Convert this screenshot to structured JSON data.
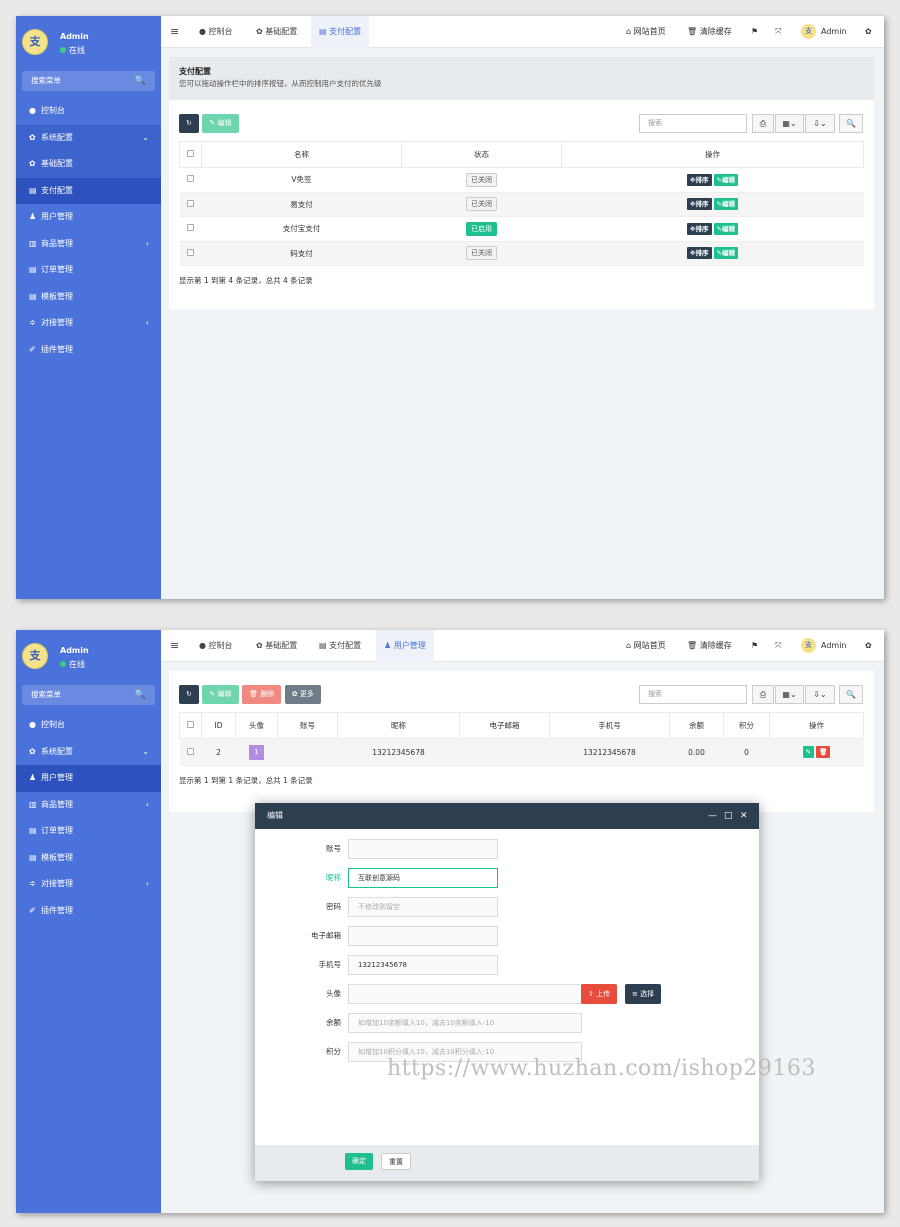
{
  "brand": {
    "logo_text": "支",
    "avatar_text": "支"
  },
  "colors": {
    "sidebar": "#4a72da",
    "accent": "#1fbf8f",
    "dark": "#2c3e50",
    "danger": "#e74c3c"
  },
  "icons": {
    "hamburger": "≡",
    "dashboard": "●",
    "gear": "✿",
    "list": "▤",
    "user": "♟",
    "cart": "▥",
    "table": "▤",
    "sliders": "≑",
    "plugin": "✐",
    "search": "🔍",
    "home": "⌂",
    "trash": "🗑",
    "flag": "⚑",
    "expand": "⤧",
    "cogs": "✿",
    "refresh": "↻",
    "pencil": "✎",
    "chevron_down": "⌄",
    "chevron_left": "‹",
    "columns": "▦",
    "export": "⇩",
    "print": "⎙",
    "move": "✥",
    "close": "✕",
    "minimize": "—",
    "maximize": "□",
    "upload": "⇧",
    "select": "≡"
  },
  "sidebar": {
    "admin_name": "Admin",
    "status": "在线",
    "search_placeholder": "搜索菜单",
    "items1": [
      {
        "icon": "●",
        "label": "控制台"
      },
      {
        "icon": "✿",
        "label": "系统配置",
        "chev": "⌄"
      },
      {
        "icon": "✿",
        "label": "基础配置"
      },
      {
        "icon": "▤",
        "label": "支付配置"
      },
      {
        "icon": "♟",
        "label": "用户管理"
      },
      {
        "icon": "▥",
        "label": "商品管理",
        "chev": "‹"
      },
      {
        "icon": "▤",
        "label": "订单管理"
      },
      {
        "icon": "▤",
        "label": "模板管理"
      },
      {
        "icon": "≑",
        "label": "对接管理",
        "chev": "‹"
      },
      {
        "icon": "✐",
        "label": "插件管理"
      }
    ],
    "items2": [
      {
        "icon": "●",
        "label": "控制台"
      },
      {
        "icon": "✿",
        "label": "系统配置",
        "chev": "⌄"
      },
      {
        "icon": "♟",
        "label": "用户管理"
      },
      {
        "icon": "▥",
        "label": "商品管理",
        "chev": "‹"
      },
      {
        "icon": "▤",
        "label": "订单管理"
      },
      {
        "icon": "▤",
        "label": "模板管理"
      },
      {
        "icon": "≑",
        "label": "对接管理",
        "chev": "‹"
      },
      {
        "icon": "✐",
        "label": "插件管理"
      }
    ]
  },
  "topbar": {
    "tabs1": [
      "控制台",
      "基础配置",
      "支付配置"
    ],
    "tabs2": [
      "控制台",
      "基础配置",
      "支付配置",
      "用户管理"
    ],
    "home_link": "网站首页",
    "clear_cache": "清除缓存",
    "user": "Admin"
  },
  "screen1": {
    "panel_title": "支付配置",
    "panel_desc": "您可以拖动操作栏中的排序按钮，从而控制用户支付的优先级",
    "edit_button": "编辑",
    "search_placeholder": "搜索",
    "headers": [
      "名称",
      "状态",
      "操作"
    ],
    "rows": [
      {
        "name": "V免签",
        "status": "已关闭",
        "on": false
      },
      {
        "name": "易支付",
        "status": "已关闭",
        "on": false
      },
      {
        "name": "支付宝支付",
        "status": "已启用",
        "on": true
      },
      {
        "name": "码支付",
        "status": "已关闭",
        "on": false
      }
    ],
    "row_actions": {
      "sort": "排序",
      "edit": "编辑"
    },
    "footer": "显示第 1 到第 4 条记录，总共 4 条记录"
  },
  "screen2": {
    "buttons": {
      "edit": "编辑",
      "delete": "删除",
      "more": "更多"
    },
    "search_placeholder": "搜索",
    "headers": [
      "ID",
      "头像",
      "账号",
      "昵称",
      "电子邮箱",
      "手机号",
      "余额",
      "积分",
      "操作"
    ],
    "rows": [
      {
        "id": "2",
        "avatar": "1",
        "account": "",
        "nickname": "13212345678",
        "email": "",
        "phone": "13212345678",
        "balance": "0.00",
        "points": "0"
      }
    ],
    "footer": "显示第 1 到第 1 条记录，总共 1 条记录"
  },
  "dialog": {
    "title": "编辑",
    "fields": [
      {
        "label": "账号",
        "value": "",
        "placeholder": ""
      },
      {
        "label": "昵称",
        "value": "互联创意源码",
        "placeholder": ""
      },
      {
        "label": "密码",
        "value": "",
        "placeholder": "不修改则留空"
      },
      {
        "label": "电子邮箱",
        "value": "",
        "placeholder": ""
      },
      {
        "label": "手机号",
        "value": "13212345678",
        "placeholder": ""
      },
      {
        "label": "头像",
        "value": "",
        "placeholder": ""
      },
      {
        "label": "余额",
        "value": "",
        "placeholder": "如增加10余额填入10，减去10余额填入-10"
      },
      {
        "label": "积分",
        "value": "",
        "placeholder": "如增加10积分填入10，减去10积分填入-10"
      }
    ],
    "upload_button": "上传",
    "select_button": "选择",
    "confirm_button": "确定",
    "reset_button": "重置"
  },
  "watermark": "https://www.huzhan.com/ishop29163"
}
